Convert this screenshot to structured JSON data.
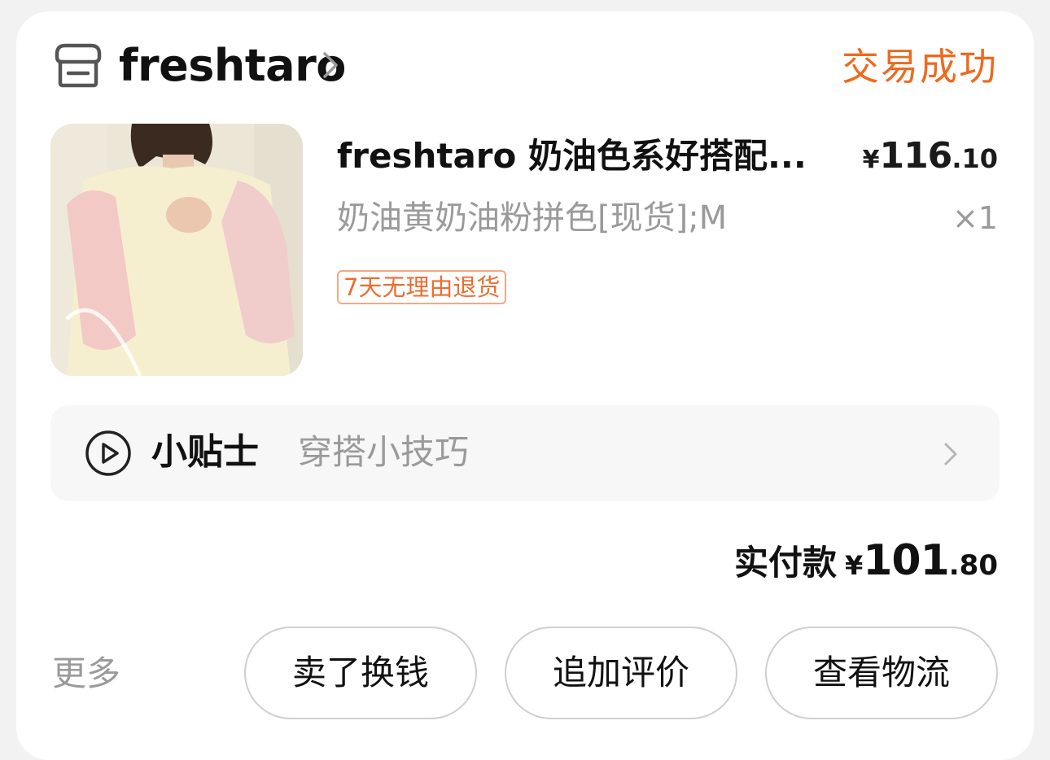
{
  "shop": {
    "name": "freshtaro",
    "status": "交易成功",
    "status_color": "#ee6a1e",
    "icon": "store-icon"
  },
  "product": {
    "title": "freshtaro 奶油色系好搭配...",
    "price_symbol": "¥",
    "price_int": "116",
    "price_dec": ".10",
    "variant": "奶油黄奶油粉拼色[现货];M",
    "quantity": "×1",
    "return_tag": "7天无理由退货"
  },
  "tips": {
    "label": "小贴士",
    "subtitle": "穿搭小技巧",
    "icon": "play-circle-icon"
  },
  "payment": {
    "label": "实付款",
    "symbol": "¥",
    "amount_int": "101",
    "amount_dec": ".80"
  },
  "footer": {
    "more": "更多",
    "buttons": [
      "卖了换钱",
      "追加评价",
      "查看物流"
    ]
  }
}
